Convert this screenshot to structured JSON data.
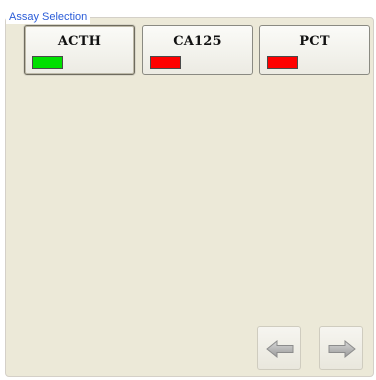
{
  "group": {
    "title": "Assay Selection"
  },
  "assays": [
    {
      "name": "ACTH",
      "status_color": "#00e000",
      "selected": true
    },
    {
      "name": "CA125",
      "status_color": "#ff0000",
      "selected": false
    },
    {
      "name": "PCT",
      "status_color": "#ff0000",
      "selected": false
    }
  ],
  "navigation": {
    "back_icon": "arrow-left-icon",
    "forward_icon": "arrow-right-icon"
  }
}
